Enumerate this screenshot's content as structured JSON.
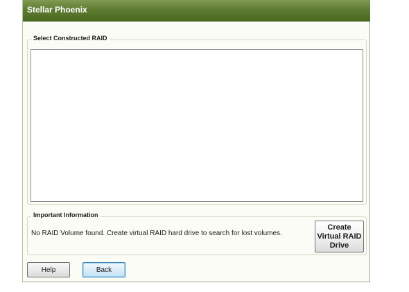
{
  "window": {
    "title": "Stellar Phoenix"
  },
  "raid_group": {
    "legend": "Select Constructed RAID",
    "items": []
  },
  "info_group": {
    "legend": "Important Information",
    "message": "No RAID Volume found. Create virtual RAID hard drive to search for lost volumes.",
    "create_button_label": "Create\nVirtual RAID\nDrive"
  },
  "footer": {
    "help_label": "Help",
    "back_label": "Back"
  },
  "colors": {
    "titlebar": "#5f7d32",
    "window_bg": "#fbfcf6",
    "focus_border": "#3c7fb1"
  }
}
